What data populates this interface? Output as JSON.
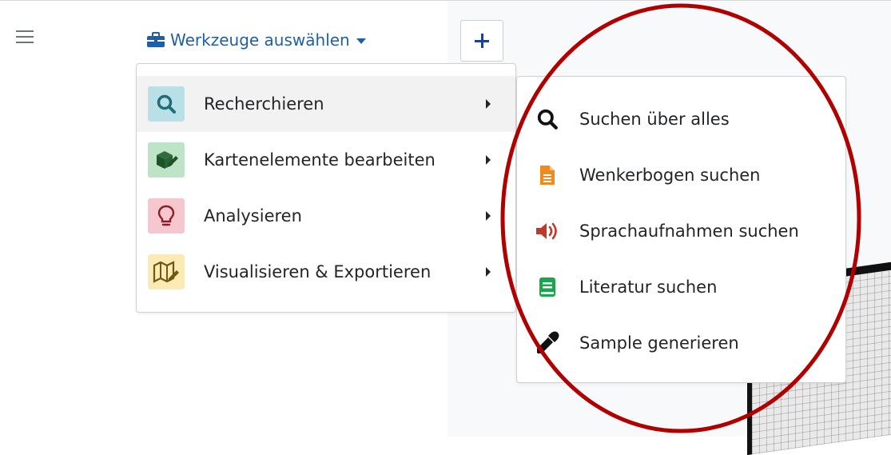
{
  "header": {
    "menu_icon": "hamburger-icon",
    "tools_label": "Werkzeuge auswählen",
    "tools_icon": "briefcase-icon",
    "add_icon": "plus-icon"
  },
  "menu": {
    "items": [
      {
        "label": "Recherchieren",
        "icon": "search-icon",
        "bg": "#b9e0e6",
        "active": true
      },
      {
        "label": "Kartenelemente bearbeiten",
        "icon": "edit-cube-icon",
        "bg": "#bfe3c6"
      },
      {
        "label": "Analysieren",
        "icon": "lightbulb-icon",
        "bg": "#f6c7cf"
      },
      {
        "label": "Visualisieren & Exportieren",
        "icon": "map-pencil-icon",
        "bg": "#fbeab4"
      }
    ]
  },
  "submenu": {
    "items": [
      {
        "label": "Suchen über alles",
        "icon": "search-icon"
      },
      {
        "label": "Wenkerbogen suchen",
        "icon": "document-icon",
        "color": "#f08a1c"
      },
      {
        "label": "Sprachaufnahmen suchen",
        "icon": "speaker-icon",
        "color": "#c0392b"
      },
      {
        "label": "Literatur suchen",
        "icon": "book-icon",
        "color": "#1aa64b"
      },
      {
        "label": "Sample generieren",
        "icon": "pipette-icon"
      }
    ]
  },
  "colors": {
    "accent": "#1f5ea8",
    "annotation": "#b00000"
  }
}
